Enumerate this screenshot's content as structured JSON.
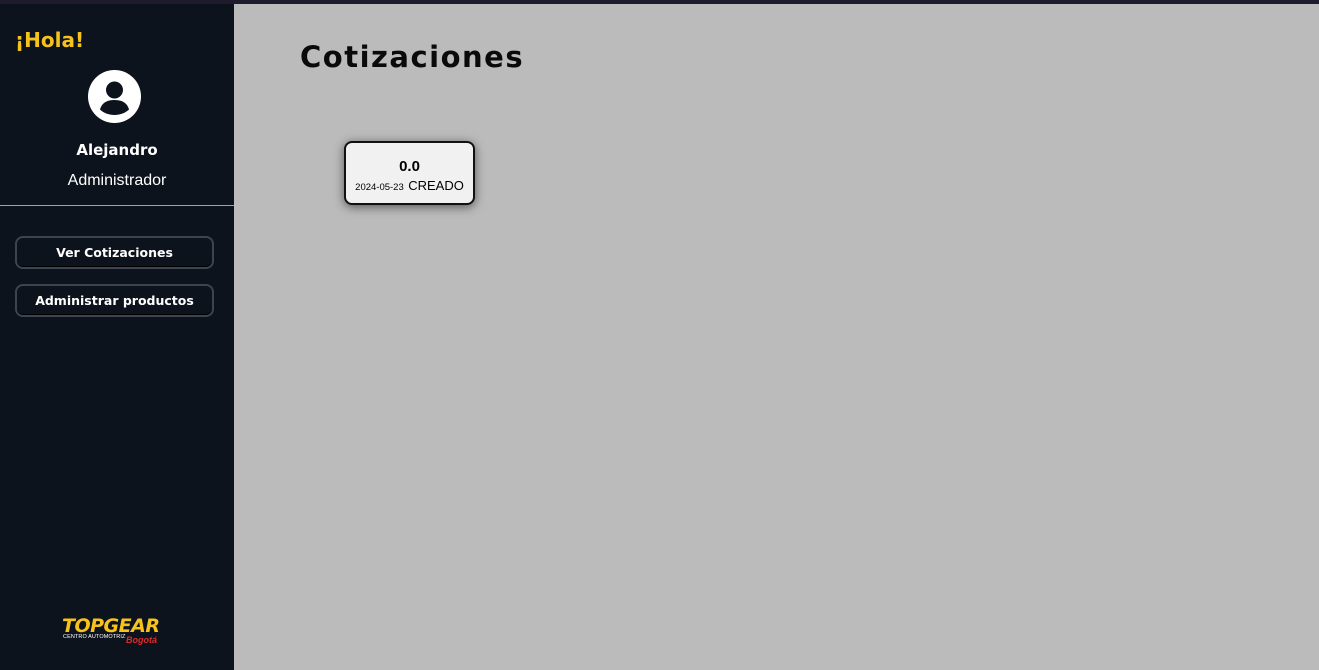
{
  "sidebar": {
    "greeting": "¡Hola!",
    "user": {
      "name": "Alejandro",
      "role": "Administrador"
    },
    "nav": [
      {
        "label": "Ver Cotizaciones"
      },
      {
        "label": "Administrar productos"
      }
    ],
    "logo": {
      "brand": "TOPGEAR",
      "tagline": "CENTRO AUTOMOTRIZ",
      "city": "Bogotá"
    }
  },
  "main": {
    "title": "Cotizaciones",
    "quotes": [
      {
        "total": "0.0",
        "date": "2024-05-23",
        "status": "CREADO"
      }
    ]
  },
  "colors": {
    "accent": "#f6c21c",
    "sidebar_bg": "#0d131c",
    "main_bg": "#bbbbbb",
    "city_red": "#e02a2a"
  },
  "icons": [
    "user-avatar-icon"
  ]
}
